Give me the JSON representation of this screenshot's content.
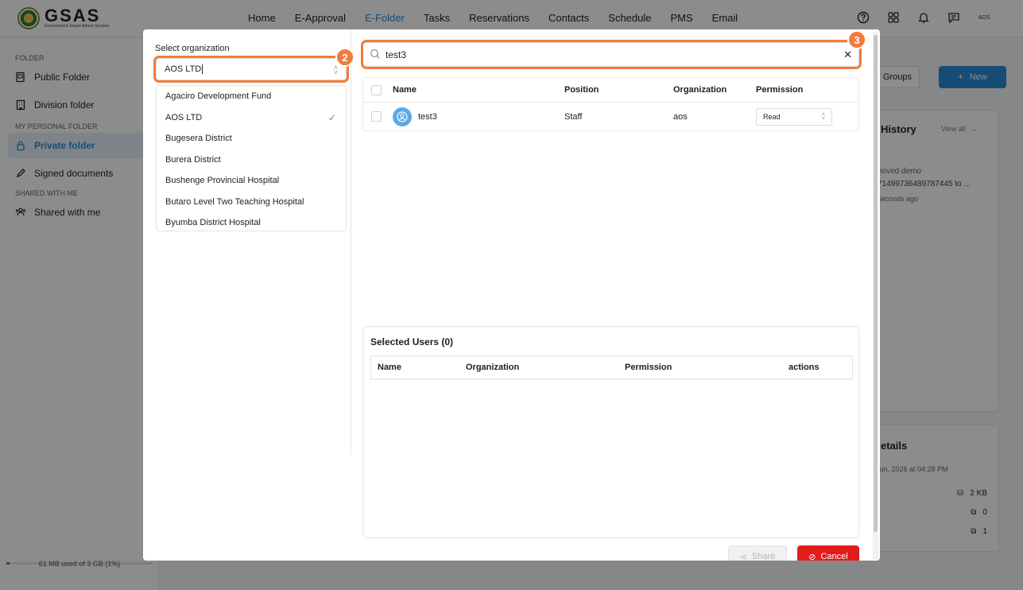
{
  "app": {
    "logo_title": "GSAS",
    "logo_subtitle": "Government Smart Admin System",
    "nav": [
      "Home",
      "E-Approval",
      "E-Folder",
      "Tasks",
      "Reservations",
      "Contacts",
      "Schedule",
      "PMS",
      "Email"
    ],
    "active_nav": "E-Folder",
    "user_short": "AOS"
  },
  "sidebar": {
    "section_folder": "FOLDER",
    "public_folder": "Public Folder",
    "division_folder": "Division folder",
    "section_personal": "MY PERSONAL FOLDER",
    "private_folder": "Private folder",
    "signed_documents": "Signed documents",
    "section_shared": "SHARED WITH ME",
    "shared_with_me": "Shared with me",
    "storage_text": "61 MB used of 3 GB (1%)",
    "storage_fraction": 0.02
  },
  "background_right": {
    "groups_label": "Groups",
    "new_label": "New",
    "history_title": "History",
    "view_all": "View all",
    "history_line1": "noved demo",
    "history_line2": "71499736489787445 to ...",
    "history_line3": "seconds ago",
    "details_title": "etails",
    "details_date": "Jun, 2026 at 04:28 PM",
    "size": "2 KB",
    "count1": "0",
    "count2": "1"
  },
  "modal": {
    "select_org_label": "Select organization",
    "selected_org": "AOS LTD",
    "org_options": [
      "Agaciro Development Fund",
      "AOS LTD",
      "Bugesera District",
      "Burera District",
      "Bushenge Provincial Hospital",
      "Butaro Level Two Teaching Hospital",
      "Byumba District Hospital"
    ],
    "search_value": "test3",
    "columns": {
      "name": "Name",
      "position": "Position",
      "organization": "Organization",
      "permission": "Permission"
    },
    "users": [
      {
        "name": "test3",
        "position": "Staff",
        "organization": "aos",
        "permission": "Read"
      }
    ],
    "selected_title": "Selected Users (0)",
    "selected_columns": {
      "name": "Name",
      "organization": "Organization",
      "permission": "Permission",
      "actions": "actions"
    },
    "share_label": "Share",
    "cancel_label": "Cancel",
    "badge_org": "2",
    "badge_search": "3"
  },
  "colors": {
    "accent": "#2b8bd6",
    "highlight": "#f47b3c",
    "danger": "#e31b1b"
  }
}
